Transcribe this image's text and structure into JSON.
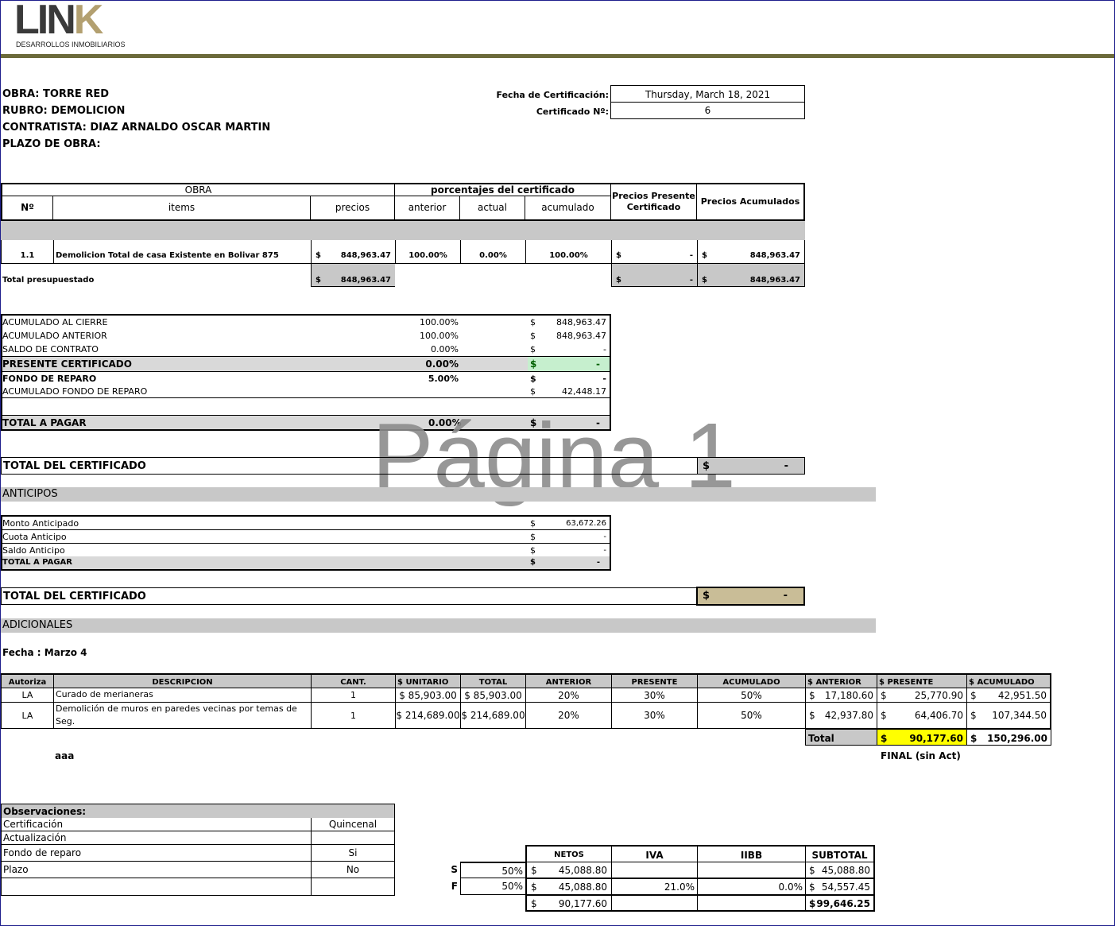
{
  "logo": {
    "main": "LIN",
    "accent": "K",
    "sub": "DESARROLLOS INMOBILIARIOS"
  },
  "colors": {
    "brand_dark": "#3a3a3a",
    "brand_gold": "#b3a070",
    "olive_bar": "#6b6a3a",
    "frame": "#1e1e8c",
    "highlight_yellow": "#ffff00",
    "highlight_green": "#c6efce",
    "tan": "#c9bd97"
  },
  "header": {
    "obra": "OBRA: TORRE RED",
    "rubro": "RUBRO: DEMOLICION",
    "contratista": "CONTRATISTA: DIAZ ARNALDO OSCAR MARTIN",
    "plazo": "PLAZO DE OBRA:",
    "fecha_label": "Fecha de Certificación:",
    "fecha_value": "Thursday, March 18, 2021",
    "cert_label": "Certificado Nº:",
    "cert_value": "6"
  },
  "main_table": {
    "h_obra": "OBRA",
    "h_porc": "porcentajes del certificado",
    "h_presente": "Precios Presente Certificado",
    "h_acum": "Precios Acumulados",
    "h_n": "Nº",
    "h_items": "items",
    "h_precios": "precios",
    "h_anterior": "anterior",
    "h_actual": "actual",
    "h_acumulado": "acumulado",
    "row": {
      "n": "1.1",
      "item": "Demolicion Total de casa Existente en Bolivar 875",
      "cur": "$",
      "precio": "848,963.47",
      "anterior": "100.00%",
      "actual": "0.00%",
      "acumulado": "100.00%",
      "presente": "-",
      "acumulados": "848,963.47"
    },
    "total": {
      "label": "Total presupuestado",
      "cur": "$",
      "precio": "848,963.47",
      "presente": "-",
      "acumulados": "848,963.47"
    }
  },
  "summary": [
    {
      "label": "ACUMULADO AL CIERRE",
      "pct": "100.00%",
      "cur": "$",
      "val": "848,963.47",
      "bold": false
    },
    {
      "label": "ACUMULADO ANTERIOR",
      "pct": "100.00%",
      "cur": "$",
      "val": "848,963.47",
      "bold": false
    },
    {
      "label": "SALDO DE CONTRATO",
      "pct": "0.00%",
      "cur": "$",
      "val": "-",
      "bold": false
    },
    {
      "label": "PRESENTE CERTIFICADO",
      "pct": "0.00%",
      "cur": "$",
      "val": "-",
      "bold": true
    },
    {
      "label": "FONDO DE REPARO",
      "pct": "5.00%",
      "cur": "$",
      "val": "-",
      "bold": true
    },
    {
      "label": "ACUMULADO FONDO DE REPARO",
      "pct": "",
      "cur": "$",
      "val": "42,448.17",
      "bold": false
    }
  ],
  "total_pagar": {
    "label": "TOTAL A PAGAR",
    "pct": "0.00%",
    "cur": "$",
    "val": "-"
  },
  "watermark": "Página 1",
  "total_cert1": {
    "label": "TOTAL DEL CERTIFICADO",
    "cur": "$",
    "val": "-"
  },
  "anticipos": {
    "title": "ANTICIPOS",
    "rows": [
      {
        "label": "Monto Anticipado",
        "cur": "$",
        "val": "63,672.26"
      },
      {
        "label": "Cuota Anticipo",
        "cur": "$",
        "val": "-"
      },
      {
        "label": "Saldo Anticipo",
        "cur": "$",
        "val": "-"
      }
    ],
    "total": {
      "label": "TOTAL A PAGAR",
      "cur": "$",
      "val": "-"
    }
  },
  "total_cert2": {
    "label": "TOTAL DEL CERTIFICADO",
    "cur": "$",
    "val": "-"
  },
  "adicionales": {
    "title": "ADICIONALES",
    "fecha": "Fecha :  Marzo 4",
    "headers": [
      "Autoriza",
      "DESCRIPCION",
      "CANT.",
      "$ UNITARIO",
      "TOTAL",
      "ANTERIOR",
      "PRESENTE",
      "ACUMULADO",
      "$ ANTERIOR",
      "$ PRESENTE",
      "$ ACUMULADO"
    ],
    "rows": [
      {
        "autoriza": "LA",
        "desc1": "Curado de merianeras",
        "desc2": "",
        "cant": "1",
        "unit": "$ 85,903.00",
        "total": "$ 85,903.00",
        "anterior": "20%",
        "presente": "30%",
        "acumulado": "50%",
        "s_ant": "17,180.60",
        "s_pre": "25,770.90",
        "s_acu": "42,951.50"
      },
      {
        "autoriza": "LA",
        "desc1": "Demolición de muros en paredes vecinas por temas de",
        "desc2": "Seg.",
        "cant": "1",
        "unit": "$ 214,689.00",
        "total": "$ 214,689.00",
        "anterior": "20%",
        "presente": "30%",
        "acumulado": "50%",
        "s_ant": "42,937.80",
        "s_pre": "64,406.70",
        "s_acu": "107,344.50"
      }
    ],
    "total_label": "Total",
    "cur": "$",
    "total_presente": "90,177.60",
    "total_acum": "150,296.00",
    "note_left": "aaa",
    "note_right": "FINAL (sin Act)"
  },
  "observaciones": {
    "title": "Observaciones:",
    "rows": [
      {
        "label": "Certificación",
        "val": "Quincenal"
      },
      {
        "label": "Actualización",
        "val": ""
      },
      {
        "label": "Fondo de reparo",
        "val": "Si"
      },
      {
        "label": "Plazo",
        "val": "No"
      },
      {
        "label": "",
        "val": ""
      }
    ]
  },
  "netos": {
    "headers": [
      "NETOS",
      "IVA",
      "IIBB",
      "SUBTOTAL"
    ],
    "rows": [
      {
        "tag": "S",
        "pct": "50%",
        "cur": "$",
        "neto": "45,088.80",
        "iva": "",
        "iibb": "",
        "sub": "45,088.80"
      },
      {
        "tag": "F",
        "pct": "50%",
        "cur": "$",
        "neto": "45,088.80",
        "iva": "21.0%",
        "iibb": "0.0%",
        "sub": "54,557.45"
      },
      {
        "tag": "",
        "pct": "",
        "cur": "$",
        "neto": "90,177.60",
        "iva": "",
        "iibb": "",
        "sub": "99,646.25"
      }
    ]
  }
}
